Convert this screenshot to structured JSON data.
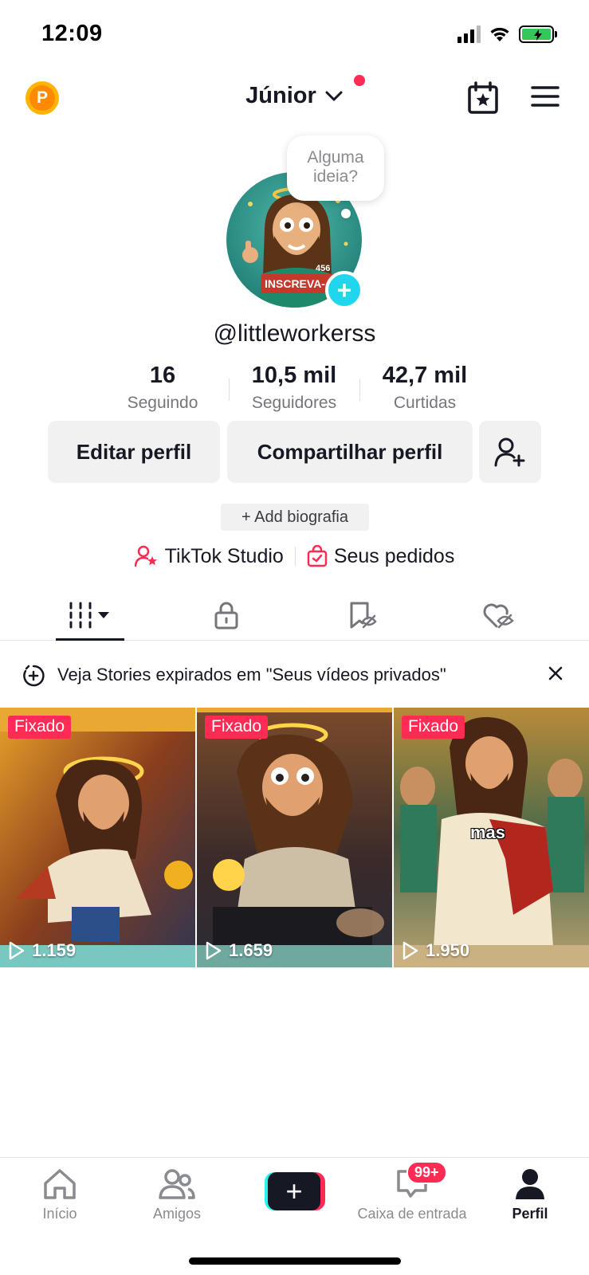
{
  "status_bar": {
    "time": "12:09"
  },
  "header": {
    "name": "Júnior"
  },
  "avatar": {
    "bubble_text": "Alguma ideia?",
    "sticker_text": "INSCREVA-",
    "number_text": "456"
  },
  "profile": {
    "username": "@littleworkerss"
  },
  "stats": [
    {
      "value": "16",
      "label": "Seguindo"
    },
    {
      "value": "10,5 mil",
      "label": "Seguidores"
    },
    {
      "value": "42,7 mil",
      "label": "Curtidas"
    }
  ],
  "actions": {
    "edit": "Editar perfil",
    "share": "Compartilhar perfil",
    "bio": "+ Add biografia"
  },
  "links": {
    "studio": "TikTok Studio",
    "orders": "Seus pedidos"
  },
  "banner": {
    "text": "Veja Stories expirados em \"Seus vídeos privados\""
  },
  "videos": [
    {
      "badge": "Fixado",
      "views": "1.159",
      "caption": ""
    },
    {
      "badge": "Fixado",
      "views": "1.659",
      "caption": ""
    },
    {
      "badge": "Fixado",
      "views": "1.950",
      "caption": "mas"
    }
  ],
  "bottom_nav": {
    "home": "Início",
    "friends": "Amigos",
    "inbox": "Caixa de entrada",
    "inbox_badge": "99+",
    "profile": "Perfil"
  },
  "colors": {
    "accent": "#fe2c55",
    "cyan": "#25f4ee",
    "avatar_plus": "#20d5ec"
  }
}
